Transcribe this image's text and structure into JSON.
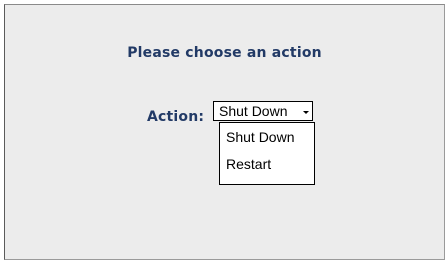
{
  "heading": "Please choose an action",
  "action_label": "Action:",
  "select": {
    "selected": "Shut Down",
    "options": [
      "Shut Down",
      "Restart"
    ]
  },
  "colors": {
    "panel_background": "#ececec",
    "label_text": "#223a66"
  }
}
